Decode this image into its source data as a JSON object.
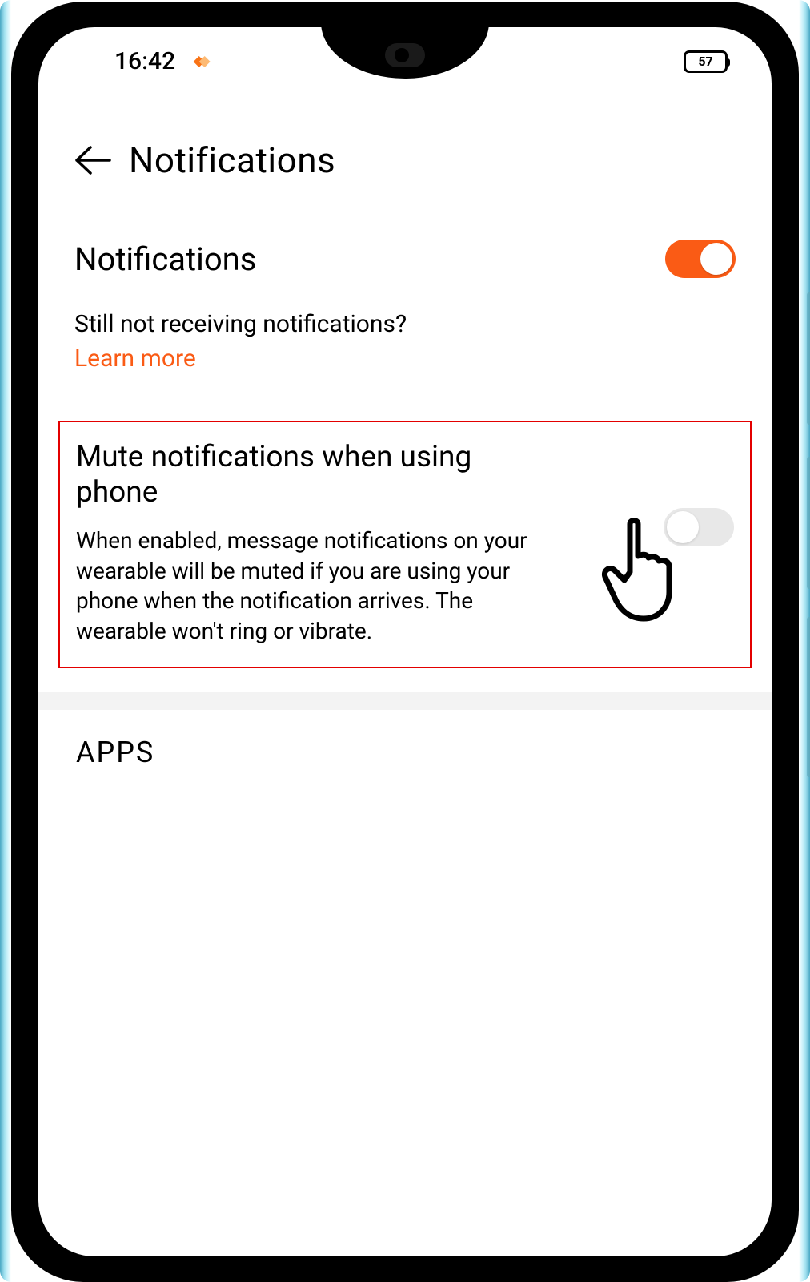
{
  "statusbar": {
    "time": "16:42",
    "battery": "57"
  },
  "accent_color": "#fa5b15",
  "header": {
    "title": "Notifications"
  },
  "notifications": {
    "label": "Notifications",
    "enabled": true,
    "help_question": "Still not receiving notifications?",
    "learn_more": "Learn more"
  },
  "mute": {
    "title": "Mute notifications when using phone",
    "description": "When enabled, message notifications on your wearable will be muted if you are using your phone when the notification arrives. The wearable won't ring or vibrate.",
    "enabled": false
  },
  "apps_header": "APPS"
}
